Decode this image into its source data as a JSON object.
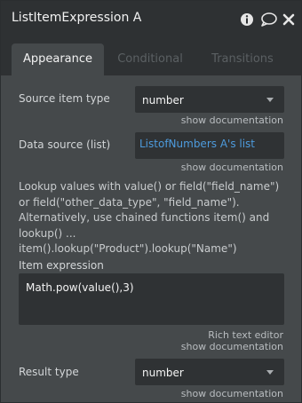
{
  "window": {
    "title": "ListItemExpression A"
  },
  "tabs": [
    {
      "label": "Appearance"
    },
    {
      "label": "Conditional"
    },
    {
      "label": "Transitions"
    }
  ],
  "source_item_type": {
    "label": "Source item type",
    "value": "number",
    "doc_link": "show documentation"
  },
  "data_source": {
    "label": "Data source (list)",
    "value": "ListofNumbers A's list",
    "doc_link": "show documentation"
  },
  "help_text": "Lookup values with value() or field(\"field_name\") or field(\"other_data_type\", \"field_name\"). Alternatively, use chained functions item() and lookup() ... item().lookup(\"Product\").lookup(\"Name\")",
  "item_expression": {
    "label": "Item expression",
    "value": "Math.pow(value(),3)",
    "rich_text_link": "Rich text editor",
    "doc_link": "show documentation"
  },
  "result_type": {
    "label": "Result type",
    "value": "number",
    "doc_link": "show documentation"
  },
  "colors": {
    "background": "#45494b",
    "header": "#2e3133",
    "field": "#2f3234",
    "link": "#4d9bdd"
  },
  "icons": [
    "info-icon",
    "comment-icon",
    "close-icon",
    "chevron-down-icon"
  ]
}
